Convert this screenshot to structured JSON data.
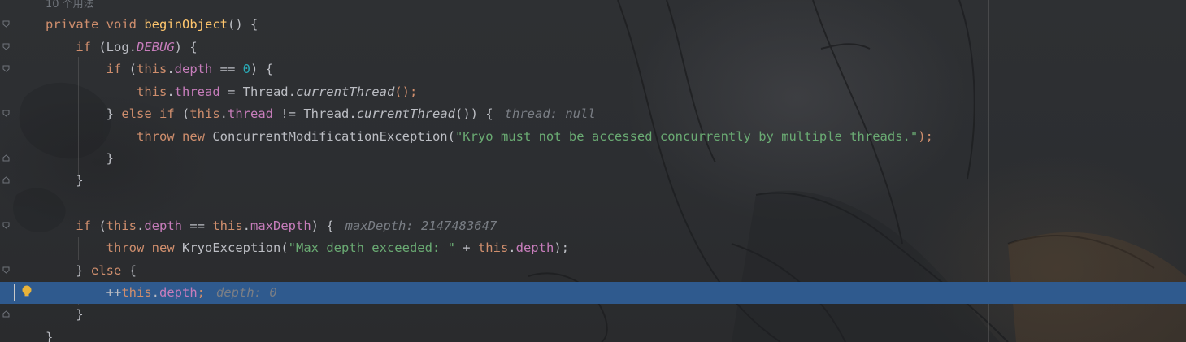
{
  "editor": {
    "usage_hint": "10 个用法",
    "colors": {
      "keyword": "#cf8e6d",
      "method": "#56a8f5",
      "field": "#c77dbb",
      "number": "#2aacb8",
      "string": "#6aab73",
      "text": "#bcbec4",
      "current_line": "#2f5a8e",
      "debug_value": "#7a7e85"
    },
    "lines": {
      "l1": {
        "kw1": "private",
        "kw2": "void",
        "method": "beginObject",
        "rest": "() {"
      },
      "l2": {
        "kw": "if",
        "p1": " (Log.",
        "const": "DEBUG",
        "p2": ") {"
      },
      "l3": {
        "kw": "if",
        "p1": " (",
        "this": "this",
        "dot": ".",
        "field": "depth",
        "op": " == ",
        "num": "0",
        "p2": ") {"
      },
      "l4": {
        "this": "this",
        "dot": ".",
        "field": "thread",
        "p1": " = Thread.",
        "call": "currentThread",
        "p2": "();"
      },
      "l5": {
        "p0": "} ",
        "kw1": "else",
        "sp": " ",
        "kw2": "if",
        "p1": " (",
        "this": "this",
        "dot": ".",
        "field": "thread",
        "p2": " != Thread.",
        "call": "currentThread",
        "p3": "()) {",
        "debug": "thread: null"
      },
      "l6": {
        "kw1": "throw",
        "sp": " ",
        "kw2": "new",
        "p1": " ConcurrentModificationException(",
        "str": "\"Kryo must not be accessed concurrently by multiple threads.\"",
        "p2": ");"
      },
      "l7": {
        "text": "}"
      },
      "l8": {
        "text": "}"
      },
      "l10": {
        "kw": "if",
        "p1": " (",
        "this1": "this",
        "dot1": ".",
        "field1": "depth",
        "op": " == ",
        "this2": "this",
        "dot2": ".",
        "field2": "maxDepth",
        "p2": ") {",
        "debug": "maxDepth: 2147483647"
      },
      "l11": {
        "kw1": "throw",
        "sp": " ",
        "kw2": "new",
        "p1": " KryoException(",
        "str": "\"Max depth exceeded: \"",
        "p2": " + ",
        "this": "this",
        "dot": ".",
        "field": "depth",
        "p3": ");"
      },
      "l12": {
        "p0": "} ",
        "kw": "else",
        "p1": " {"
      },
      "l13": {
        "op": "++",
        "this": "this",
        "dot": ".",
        "field": "depth",
        "semi": ";",
        "debug": "depth: 0"
      },
      "l14": {
        "text": "}"
      },
      "l15": {
        "text": "}"
      }
    }
  }
}
